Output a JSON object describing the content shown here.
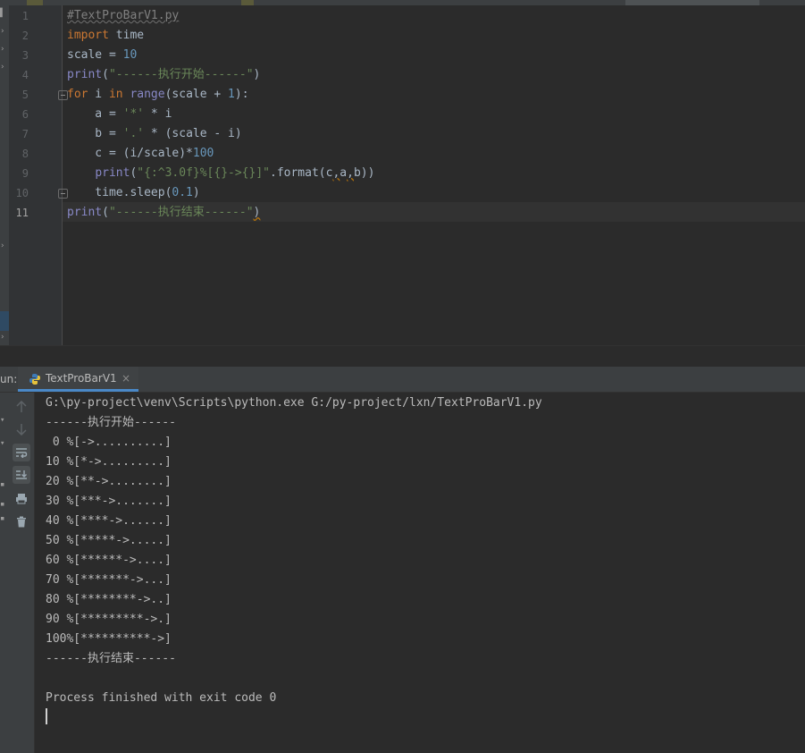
{
  "editor": {
    "line_numbers": [
      "1",
      "2",
      "3",
      "4",
      "5",
      "6",
      "7",
      "8",
      "9",
      "10",
      "11"
    ],
    "lines": [
      [
        {
          "t": "#TextProBarV1.py",
          "c": "cmt"
        }
      ],
      [
        {
          "t": "import",
          "c": "kw"
        },
        {
          "t": " time",
          "c": ""
        }
      ],
      [
        {
          "t": "scale = ",
          "c": ""
        },
        {
          "t": "10",
          "c": "num"
        }
      ],
      [
        {
          "t": "print",
          "c": "bi"
        },
        {
          "t": "(",
          "c": ""
        },
        {
          "t": "\"------执行开始------\"",
          "c": "str"
        },
        {
          "t": ")",
          "c": ""
        }
      ],
      [
        {
          "t": "for",
          "c": "kw"
        },
        {
          "t": " i ",
          "c": ""
        },
        {
          "t": "in",
          "c": "kw"
        },
        {
          "t": " ",
          "c": ""
        },
        {
          "t": "range",
          "c": "bi"
        },
        {
          "t": "(scale + ",
          "c": ""
        },
        {
          "t": "1",
          "c": "num"
        },
        {
          "t": "):",
          "c": ""
        }
      ],
      [
        {
          "t": "    a = ",
          "c": ""
        },
        {
          "t": "'*'",
          "c": "str"
        },
        {
          "t": " * i",
          "c": ""
        }
      ],
      [
        {
          "t": "    b = ",
          "c": ""
        },
        {
          "t": "'.'",
          "c": "str"
        },
        {
          "t": " * (scale - i)",
          "c": ""
        }
      ],
      [
        {
          "t": "    c = (i/scale)*",
          "c": ""
        },
        {
          "t": "100",
          "c": "num"
        }
      ],
      [
        {
          "t": "    ",
          "c": ""
        },
        {
          "t": "print",
          "c": "bi"
        },
        {
          "t": "(",
          "c": ""
        },
        {
          "t": "\"{:^3.0f}%[{}->{}]\"",
          "c": "str"
        },
        {
          "t": ".format(c",
          "c": ""
        },
        {
          "t": ",",
          "c": "squig"
        },
        {
          "t": "a",
          "c": ""
        },
        {
          "t": ",",
          "c": "squig"
        },
        {
          "t": "b))",
          "c": ""
        }
      ],
      [
        {
          "t": "    time.sleep(",
          "c": ""
        },
        {
          "t": "0.1",
          "c": "num"
        },
        {
          "t": ")",
          "c": ""
        }
      ],
      [
        {
          "t": "print",
          "c": "bi"
        },
        {
          "t": "(",
          "c": ""
        },
        {
          "t": "\"------执行结束------\"",
          "c": "str"
        },
        {
          "t": ")",
          "c": "squig"
        }
      ]
    ]
  },
  "run_panel": {
    "label": "un:",
    "tab_title": "TextProBarV1",
    "close_glyph": "×"
  },
  "console": {
    "lines": [
      "G:\\py-project\\venv\\Scripts\\python.exe G:/py-project/lxn/TextProBarV1.py",
      "------执行开始------",
      " 0 %[->..........]",
      "10 %[*->.........]",
      "20 %[**->........]",
      "30 %[***->.......]",
      "40 %[****->......]",
      "50 %[*****->.....]",
      "60 %[******->....]",
      "70 %[*******->...]",
      "80 %[********->..]",
      "90 %[*********->.]",
      "100%[**********->]",
      "------执行结束------",
      "",
      "Process finished with exit code 0"
    ]
  },
  "toolbar_icons": [
    "up-arrow-icon",
    "down-arrow-icon",
    "soft-wrap-icon",
    "scroll-to-end-icon",
    "print-icon",
    "trash-icon"
  ],
  "colors": {
    "background": "#2b2b2b",
    "keyword": "#cc7832",
    "builtin": "#8888c6",
    "string": "#6a8759",
    "number": "#6897bb",
    "tab_underline": "#4a88c7"
  }
}
